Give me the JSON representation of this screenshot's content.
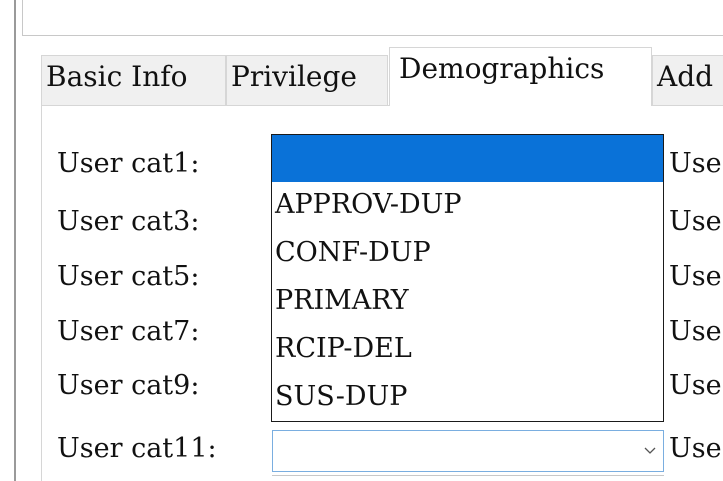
{
  "tabs": [
    {
      "label": "Basic Info",
      "active": false
    },
    {
      "label": "Privilege",
      "active": false
    },
    {
      "label": "Demographics",
      "active": true
    },
    {
      "label": "Add",
      "active": false
    }
  ],
  "form": {
    "left_labels": [
      "User cat1:",
      "User cat3:",
      "User cat5:",
      "User cat7:",
      "User cat9:",
      "User cat11:"
    ],
    "right_labels": [
      "Use",
      "Use",
      "Use",
      "Use",
      "Use",
      "Use"
    ]
  },
  "dropdown": {
    "items": [
      "",
      "APPROV-DUP",
      "CONF-DUP",
      "PRIMARY",
      "RCIP-DEL",
      "SUS-DUP"
    ],
    "selected_index": 0
  },
  "combo_cat11": {
    "value": "",
    "arrow_icon": "chevron-down-icon"
  },
  "colors": {
    "selection": "#0a72d8",
    "tab_inactive": "#f0f0f0"
  }
}
